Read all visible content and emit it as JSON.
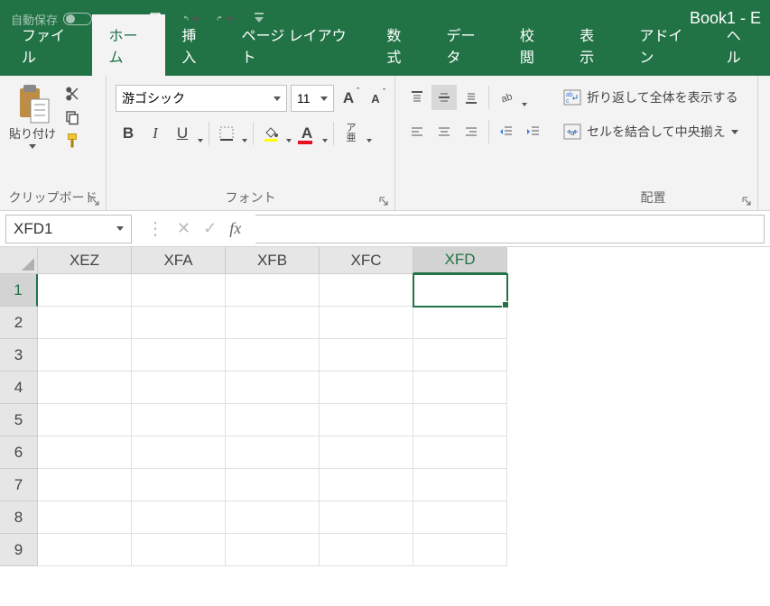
{
  "titlebar": {
    "autosave_label": "自動保存",
    "autosave_state": "オフ",
    "doc_title": "Book1  -  E"
  },
  "tabs": {
    "file": "ファイル",
    "home": "ホーム",
    "insert": "挿入",
    "page_layout": "ページ レイアウト",
    "formulas": "数式",
    "data": "データ",
    "review": "校閲",
    "view": "表示",
    "addins": "アドイン",
    "help": "ヘル"
  },
  "ribbon": {
    "clipboard": {
      "paste_label": "貼り付け",
      "group_label": "クリップボード"
    },
    "font": {
      "font_name": "游ゴシック",
      "font_size": "11",
      "group_label": "フォント"
    },
    "alignment": {
      "wrap_text": "折り返して全体を表示する",
      "merge_center": "セルを結合して中央揃え",
      "group_label": "配置"
    }
  },
  "formula_bar": {
    "name_box": "XFD1",
    "fx_label": "fx",
    "formula_value": ""
  },
  "sheet": {
    "columns": [
      "XEZ",
      "XFA",
      "XFB",
      "XFC",
      "XFD"
    ],
    "rows": [
      "1",
      "2",
      "3",
      "4",
      "5",
      "6",
      "7",
      "8",
      "9"
    ],
    "selected_col_index": 4,
    "selected_row_index": 0
  }
}
